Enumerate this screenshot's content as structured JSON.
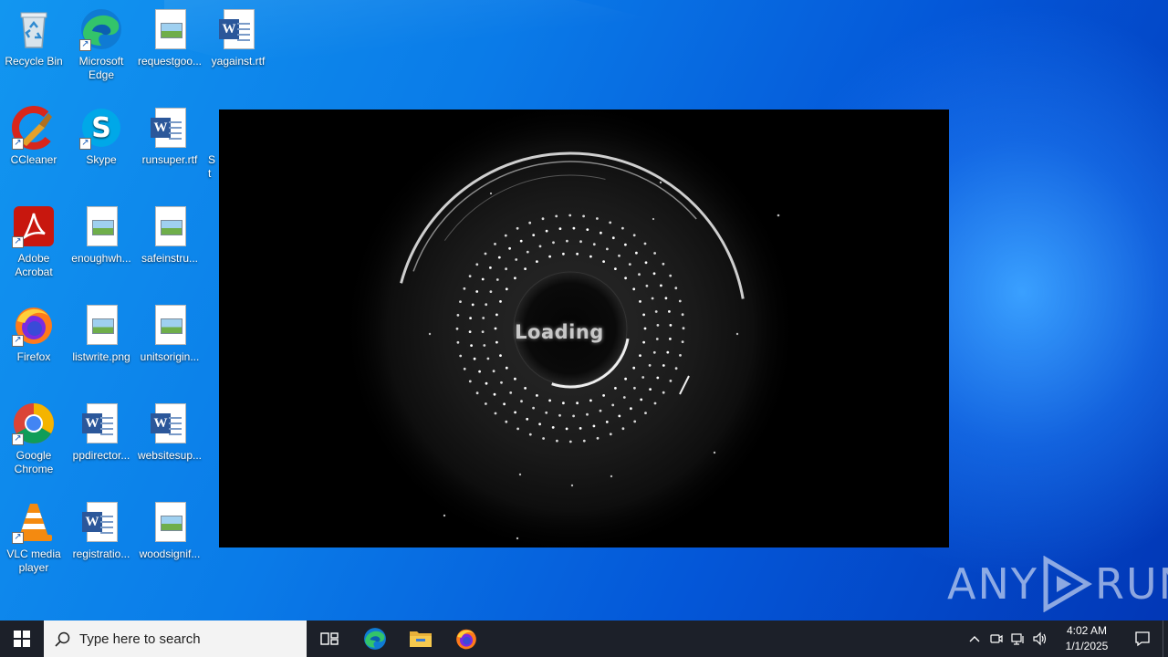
{
  "desktop": {
    "icons": [
      {
        "label": "Recycle Bin",
        "icon": "recycle-bin-icon"
      },
      {
        "label": "Microsoft Edge",
        "icon": "edge-icon"
      },
      {
        "label": "requestgoo...",
        "icon": "image-file-icon"
      },
      {
        "label": "yagainst.rtf",
        "icon": "word-doc-icon"
      },
      {
        "label": "CCleaner",
        "icon": "ccleaner-icon"
      },
      {
        "label": "Skype",
        "icon": "skype-icon"
      },
      {
        "label": "runsuper.rtf",
        "icon": "word-doc-icon"
      },
      {
        "label": "St",
        "icon": "partial-icon"
      },
      {
        "label": "Adobe Acrobat",
        "icon": "acrobat-icon"
      },
      {
        "label": "enoughwh...",
        "icon": "image-file-icon"
      },
      {
        "label": "safeinstru...",
        "icon": "image-file-icon"
      },
      {
        "label": "Firefox",
        "icon": "firefox-icon"
      },
      {
        "label": "listwrite.png",
        "icon": "image-file-icon"
      },
      {
        "label": "unitsorigin...",
        "icon": "image-file-icon"
      },
      {
        "label": "Google Chrome",
        "icon": "chrome-icon"
      },
      {
        "label": "ppdirector...",
        "icon": "word-doc-icon"
      },
      {
        "label": "websitesup...",
        "icon": "word-doc-icon"
      },
      {
        "label": "VLC media player",
        "icon": "vlc-icon"
      },
      {
        "label": "registratio...",
        "icon": "word-doc-icon"
      },
      {
        "label": "woodsignif...",
        "icon": "image-file-icon"
      }
    ]
  },
  "loader": {
    "text": "Loading"
  },
  "watermark": {
    "left": "ANY",
    "right": "RUN"
  },
  "taskbar": {
    "search_placeholder": "Type here to search",
    "pinned": [
      "task-view-icon",
      "edge-icon",
      "file-explorer-icon",
      "firefox-icon"
    ],
    "clock_time": "4:02 AM",
    "clock_date": "1/1/2025"
  },
  "colors": {
    "taskbar_bg": "#1c2029",
    "desktop_blue": "#0a7be8",
    "word_blue": "#2b579a"
  }
}
